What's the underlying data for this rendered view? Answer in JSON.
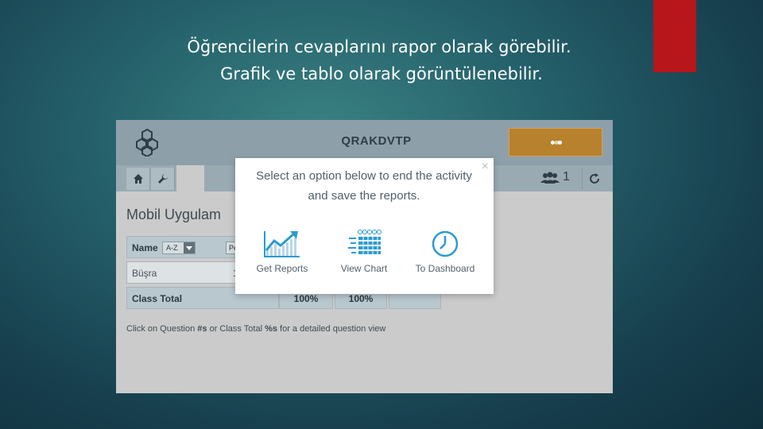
{
  "slide": {
    "headline_line1": "Öğrencilerin cevaplarını rapor olarak görebilir.",
    "headline_line2": "Grafik ve tablo olarak görüntülenebilir.",
    "accent_color": "#b7161a"
  },
  "app": {
    "title": "QRAKDVTP",
    "header_button_color": "#b7812e",
    "toolbar": {
      "home_icon": "home-icon",
      "settings_icon": "wrench-icon",
      "users_icon": "users-icon",
      "users_count": "1",
      "refresh_icon": "refresh-icon"
    },
    "page_heading": "Mobil Uygulam",
    "table": {
      "header": {
        "name_label": "Name",
        "sort_value": "A-Z",
        "pe_label": "Pe"
      },
      "rows": [
        {
          "name": "Büşra",
          "partial_value": "1"
        }
      ],
      "total": {
        "label": "Class Total",
        "values": [
          "100%",
          "100%"
        ]
      }
    },
    "hint": {
      "part1": "Click on Question ",
      "bold1": "#s",
      "part2": " or Class Total ",
      "bold2": "%s",
      "part3": " for a detailed question view"
    }
  },
  "modal": {
    "message": "Select an option below to end the activity and save the reports.",
    "close_symbol": "×",
    "options": [
      {
        "label": "Get Reports",
        "icon": "line-chart-icon"
      },
      {
        "label": "View Chart",
        "icon": "data-grid-icon"
      },
      {
        "label": "To Dashboard",
        "icon": "clock-icon"
      }
    ],
    "icon_color": "#2b9bd0"
  }
}
